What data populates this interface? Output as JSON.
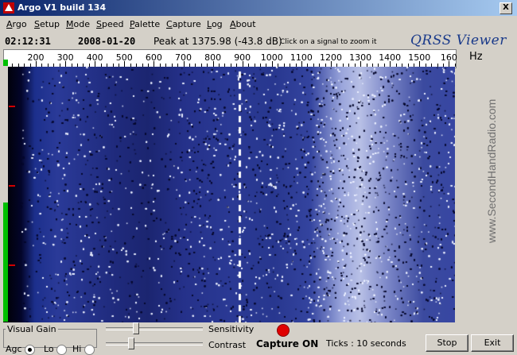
{
  "window": {
    "title": "Argo V1 build 134",
    "close_label": "X"
  },
  "menu": [
    {
      "label": "Argo",
      "ul": "A"
    },
    {
      "label": "Setup",
      "ul": "S"
    },
    {
      "label": "Mode",
      "ul": "M"
    },
    {
      "label": "Speed",
      "ul": "S"
    },
    {
      "label": "Palette",
      "ul": "P"
    },
    {
      "label": "Capture",
      "ul": "C"
    },
    {
      "label": "Log",
      "ul": "L"
    },
    {
      "label": "About",
      "ul": "A"
    }
  ],
  "info": {
    "time": "02:12:31",
    "date": "2008-01-20",
    "peak": "Peak at 1375.98 (-43.8 dB)",
    "hint": "Click on a signal to zoom it",
    "brand": "QRSS Viewer"
  },
  "axis": {
    "unit": "Hz",
    "labels": [
      "200",
      "300",
      "400",
      "500",
      "600",
      "700",
      "800",
      "900",
      "1000",
      "1100",
      "1200",
      "1300",
      "1400",
      "1500",
      "160"
    ]
  },
  "side_brand": "www.SecondHandRadio.com",
  "controls": {
    "visual_gain_label": "Visual Gain",
    "agc_label": "Agc",
    "lo_label": "Lo",
    "hi_label": "Hi",
    "selected_gain": "Agc",
    "sensitivity_label": "Sensitivity",
    "contrast_label": "Contrast",
    "capture_status": "Capture ON",
    "ticks_label": "Ticks  : 10 seconds",
    "stop_label": "Stop",
    "exit_label": "Exit"
  },
  "colors": {
    "titlebar": "#0a246a",
    "capture_dot": "#e00000",
    "level": "#00c000",
    "marker": "#d00000"
  }
}
